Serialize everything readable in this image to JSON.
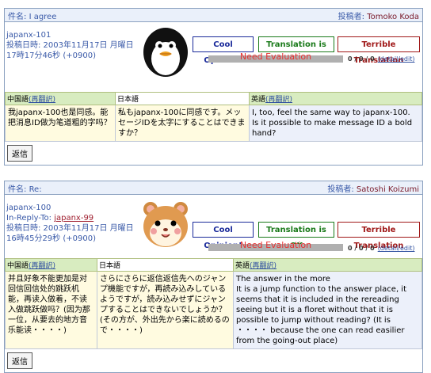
{
  "posts": [
    {
      "subject_label": "件名:",
      "subject": "I agree",
      "poster_label": "投稿者:",
      "poster": "Tomoko Koda",
      "id": "japanx-101",
      "reply_to_label": "",
      "reply_to": "",
      "date_line1": "投稿日時: 2003年11月17日 月曜日",
      "date_line2": "17時17分46秒 (+0900)",
      "avatar_icon": "penguin-icon",
      "buttons": {
        "cool": "Cool Opinion!",
        "ok": "Translation is OK",
        "bad": "Terrible Translation"
      },
      "eval_text": "Need Evaluation",
      "count": "0 / 0 / 0",
      "detail_link": "(detail/edit)",
      "headers": {
        "zh": "中国語",
        "ja": "日本語",
        "en": "英語",
        "retranslate": "(再翻訳)"
      },
      "zh": "我japanx-100也是同感。能把消息ID做为笔道粗的字吗？",
      "ja": "私もjapanx-100に同感です。メッセージIDを太字にすることはできますか？",
      "en": "I, too, feel the same way to japanx-100. Is it possible to make message ID a bold hand?",
      "reply_button": "返信"
    },
    {
      "subject_label": "件名:",
      "subject": "Re:",
      "poster_label": "投稿者:",
      "poster": "Satoshi Koizumi",
      "id": "japanx-100",
      "reply_to_label": "In-Reply-To:",
      "reply_to": "japanx-99",
      "date_line1": "投稿日時: 2003年11月17日 月曜日",
      "date_line2": "16時45分29秒 (+0900)",
      "avatar_icon": "hamster-icon",
      "buttons": {
        "cool": "Cool Opinion!",
        "ok": "Translation is OK",
        "bad": "Terrible Translation"
      },
      "eval_text": "Need Evaluation",
      "count": "0 / 0 / 0",
      "detail_link": "(detail/edit)",
      "headers": {
        "zh": "中国語",
        "ja": "日本語",
        "en": "英語",
        "retranslate": "(再翻訳)"
      },
      "zh": "并且好象不能更加是对回信回信处的跳跃机能，再读入做着，不读入做跳跃做吗？(因为那一位，从要去的地方音乐能读・・・・)",
      "ja": "さらにさらに返信返信先へのジャンプ機能ですが，再読み込みしているようですが，読み込みせずにジャンプすることはできないでしょうか？(その方が、外出先から楽に読めるので・・・・)",
      "en": "The answer in the more\nIt is a jump function to the answer place, it seems that it is included in the rereading seeing but it is a floret without that it is possible to jump without reading? (It is ・・・・ because the one can read easilier from the going-out place)",
      "reply_button": "返信"
    }
  ],
  "colors": {
    "link": "#3050a0",
    "eval": "#e83030",
    "cool": "#1a2a9a",
    "ok": "#1a7a1a",
    "bad": "#a01818"
  }
}
